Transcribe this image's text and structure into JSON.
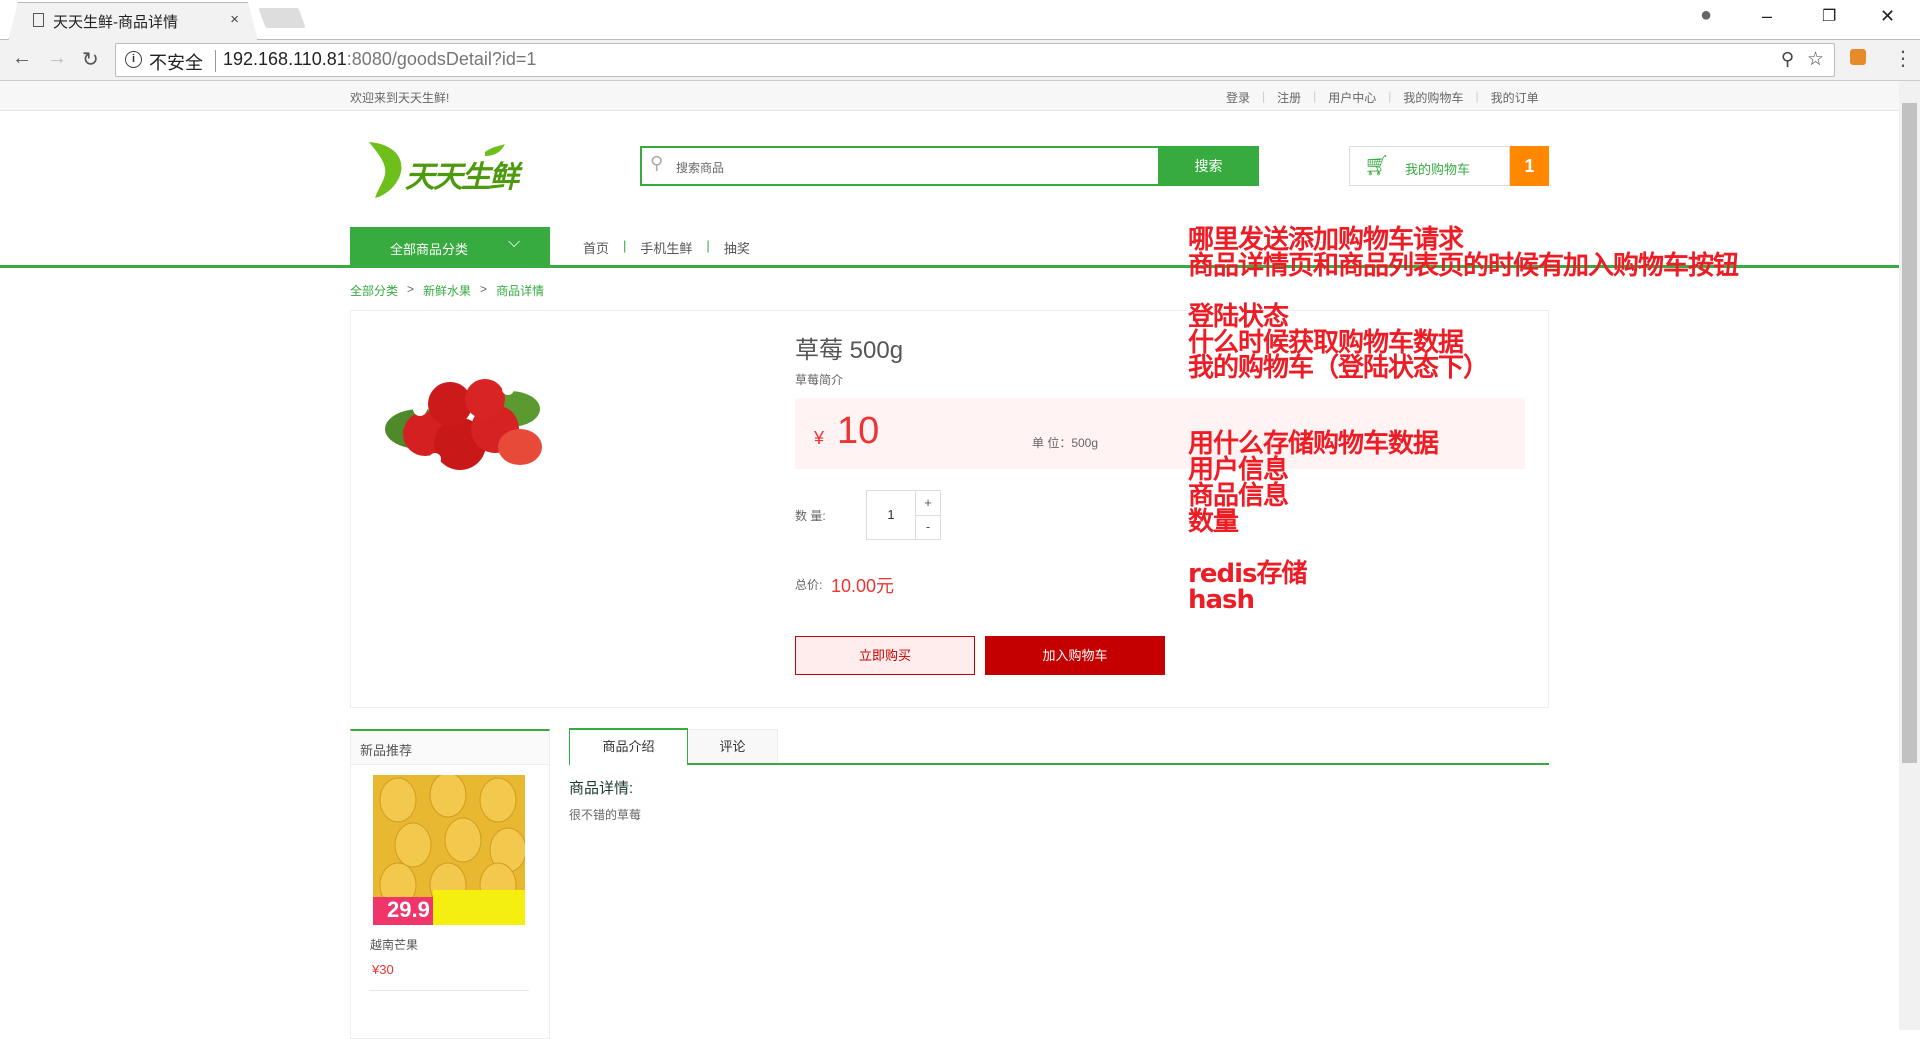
{
  "browser": {
    "tab_title": "天天生鲜-商品详情",
    "insecure_label": "不安全",
    "url_host": "192.168.110.81",
    "url_rest": ":8080/goodsDetail?id=1"
  },
  "topbar": {
    "welcome": "欢迎来到天天生鲜!",
    "links": [
      "登录",
      "注册",
      "用户中心",
      "我的购物车",
      "我的订单"
    ]
  },
  "header": {
    "logo_text": "天天生鲜",
    "search_placeholder": "搜索商品",
    "search_button": "搜索",
    "cart_label": "我的购物车",
    "cart_count": "1"
  },
  "nav": {
    "category": "全部商品分类",
    "links": [
      "首页",
      "手机生鲜",
      "抽奖"
    ]
  },
  "breadcrumb": [
    "全部分类",
    "新鲜水果",
    "商品详情"
  ],
  "product": {
    "name": "草莓 500g",
    "brief": "草莓简介",
    "currency": "¥",
    "price": "10",
    "unit": "单 位：500g",
    "qty_label": "数 量:",
    "qty": "1",
    "plus": "+",
    "minus": "-",
    "total_label": "总价:",
    "total": "10.00元",
    "buy_now": "立即购买",
    "add_cart": "加入购物车"
  },
  "annotations": [
    "哪里发送添加购物车请求",
    "商品详情页和商品列表页的时候有加入购物车按钮",
    "登陆状态",
    "什么时候获取购物车数据",
    "我的购物车（登陆状态下）",
    "用什么存储购物车数据",
    "用户信息",
    "商品信息",
    "数量",
    "redis存储",
    "hash"
  ],
  "sidebar": {
    "title": "新品推荐",
    "items": [
      {
        "name": "越南芒果",
        "price": "¥30",
        "promo_price": "29.9"
      }
    ]
  },
  "tabs": [
    "商品介绍",
    "评论"
  ],
  "detail": {
    "heading": "商品详情:",
    "text": "很不错的草莓"
  }
}
